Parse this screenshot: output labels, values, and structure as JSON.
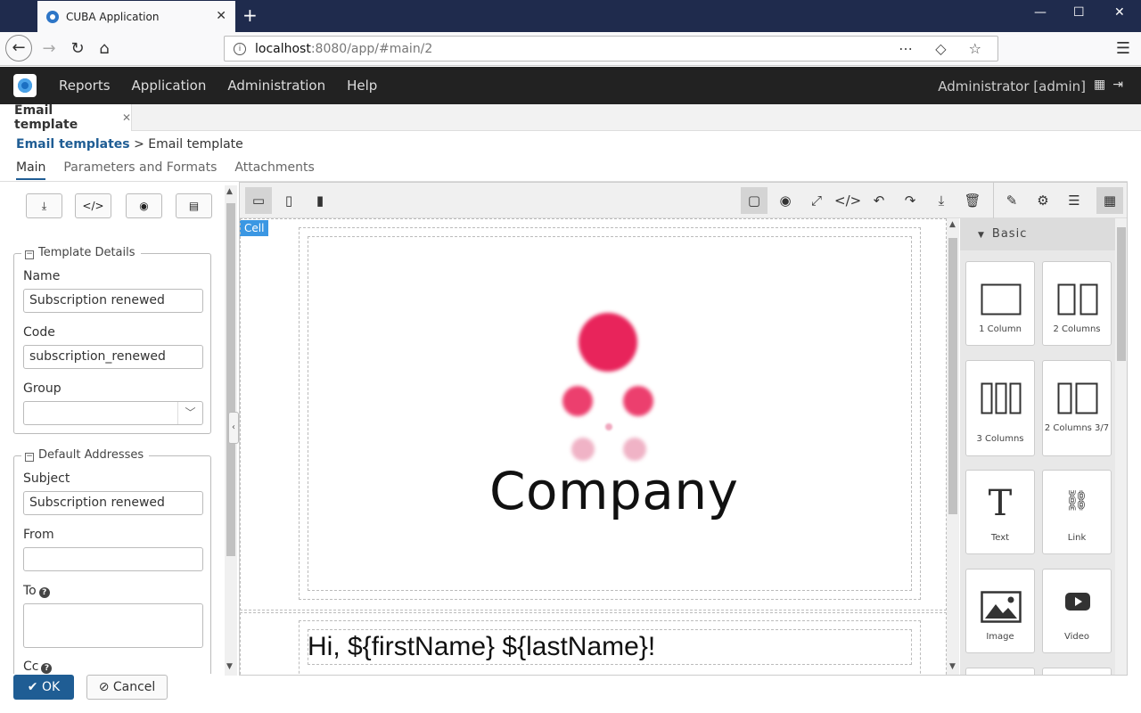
{
  "browser": {
    "tab_title": "CUBA Application",
    "url_host": "localhost",
    "url_path": ":8080/app/#main/2"
  },
  "app": {
    "menu": [
      "Reports",
      "Application",
      "Administration",
      "Help"
    ],
    "user": "Administrator [admin]"
  },
  "workarea": {
    "tab_title": "Email template"
  },
  "breadcrumb": {
    "parent": "Email templates",
    "current": "> Email template"
  },
  "subtabs": [
    "Main",
    "Parameters and Formats",
    "Attachments"
  ],
  "template_details": {
    "legend": "Template Details",
    "name_label": "Name",
    "name_value": "Subscription renewed",
    "code_label": "Code",
    "code_value": "subscription_renewed",
    "group_label": "Group",
    "group_value": ""
  },
  "default_addresses": {
    "legend": "Default Addresses",
    "subject_label": "Subject",
    "subject_value": "Subscription renewed",
    "from_label": "From",
    "from_value": "",
    "to_label": "To",
    "to_value": "",
    "cc_label": "Cc"
  },
  "editor": {
    "cell_tag": "Cell",
    "company_text": "Company",
    "greeting_text": "Hi, ${firstName} ${lastName}!",
    "blocks_header": "Basic",
    "blocks": [
      {
        "label": "1 Column"
      },
      {
        "label": "2 Columns"
      },
      {
        "label": "3 Columns"
      },
      {
        "label": "2 Columns 3/7"
      },
      {
        "label": "Text"
      },
      {
        "label": "Link"
      },
      {
        "label": "Image"
      },
      {
        "label": "Video"
      }
    ]
  },
  "footer": {
    "ok_label": "OK",
    "cancel_label": "Cancel"
  },
  "colors": {
    "accent": "#1f5d94",
    "logo_pink": "#e8245b",
    "cell_tag": "#3b97e3"
  }
}
